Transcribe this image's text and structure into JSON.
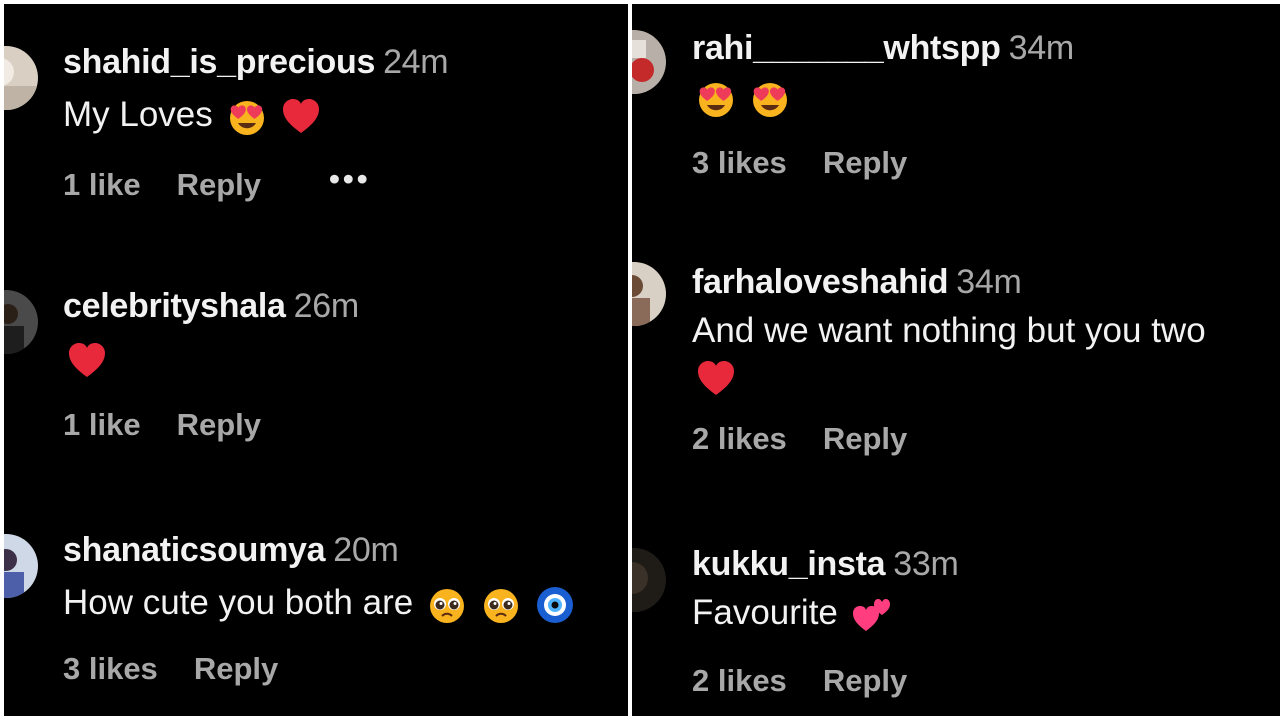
{
  "left_panel": {
    "comments": [
      {
        "username": "shahid_is_precious",
        "time": "24m",
        "text": "My Loves",
        "emojis": [
          "heart-eyes-icon",
          "red-heart-icon"
        ],
        "likes": "1 like",
        "reply": "Reply",
        "more": "•••"
      },
      {
        "username": "celebrityshala",
        "time": "26m",
        "text": "",
        "emojis": [
          "red-heart-icon"
        ],
        "likes": "1 like",
        "reply": "Reply"
      },
      {
        "username": "shanaticsoumya",
        "time": "20m",
        "text": "How cute you both are",
        "emojis": [
          "pleading-face-icon",
          "pleading-face-icon",
          "nazar-amulet-icon"
        ],
        "likes": "3 likes",
        "reply": "Reply"
      }
    ]
  },
  "right_panel": {
    "comments": [
      {
        "username": "rahi_______whtspp",
        "time": "34m",
        "text": "",
        "emojis": [
          "heart-eyes-icon",
          "heart-eyes-icon"
        ],
        "likes": "3 likes",
        "reply": "Reply"
      },
      {
        "username": "farhaloveshahid",
        "time": "34m",
        "text": "And we want nothing but you two",
        "emojis": [
          "red-heart-icon"
        ],
        "likes": "2 likes",
        "reply": "Reply"
      },
      {
        "username": "kukku_insta",
        "time": "33m",
        "text": "Favourite",
        "emojis": [
          "two-hearts-icon"
        ],
        "likes": "2 likes",
        "reply": "Reply"
      }
    ]
  },
  "colors": {
    "background": "#000000",
    "primary_text": "#f2f2f2",
    "secondary_text": "#a8a8a8",
    "heart": "#e8293b"
  }
}
